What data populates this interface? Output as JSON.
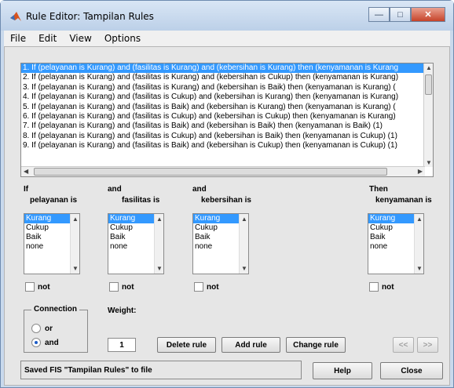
{
  "window": {
    "title": "Rule Editor: Tampilan Rules"
  },
  "menu": [
    "File",
    "Edit",
    "View",
    "Options"
  ],
  "rules": [
    "1. If (pelayanan is Kurang) and (fasilitas is Kurang) and (kebersihan is Kurang) then (kenyamanan is Kurang",
    "2. If (pelayanan is Kurang) and (fasilitas is Kurang) and (kebersihan is Cukup) then (kenyamanan is Kurang)",
    "3. If (pelayanan is Kurang) and (fasilitas is Kurang) and (kebersihan is Baik) then (kenyamanan is Kurang) (",
    "4. If (pelayanan is Kurang) and (fasilitas is Cukup) and (kebersihan is Kurang) then (kenyamanan is Kurang)",
    "5. If (pelayanan is Kurang) and (fasilitas is Baik) and (kebersihan is Kurang) then (kenyamanan is Kurang) (",
    "6. If (pelayanan is Kurang) and (fasilitas is Cukup) and (kebersihan is Cukup) then (kenyamanan is Kurang)",
    "7. If (pelayanan is Kurang) and (fasilitas is Baik) and (kebersihan is Baik) then (kenyamanan is Baik) (1)",
    "8. If (pelayanan is Kurang) and (fasilitas is Cukup) and (kebersihan is Baik) then (kenyamanan is Cukup) (1)",
    "9. If (pelayanan is Kurang) and (fasilitas is Baik) and (kebersihan is Cukup) then (kenyamanan is Cukup) (1)"
  ],
  "columns": [
    {
      "pre": "If",
      "var": "pelayanan is",
      "options": [
        "Kurang",
        "Cukup",
        "Baik",
        "none"
      ],
      "not": "not"
    },
    {
      "pre": "and",
      "var": "fasilitas is",
      "options": [
        "Kurang",
        "Cukup",
        "Baik",
        "none"
      ],
      "not": "not"
    },
    {
      "pre": "and",
      "var": "kebersihan is",
      "options": [
        "Kurang",
        "Cukup",
        "Baik",
        "none"
      ],
      "not": "not"
    },
    {
      "pre": "Then",
      "var": "kenyamanan is",
      "options": [
        "Kurang",
        "Cukup",
        "Baik",
        "none"
      ],
      "not": "not"
    }
  ],
  "connection": {
    "title": "Connection",
    "or": "or",
    "and": "and"
  },
  "weight": {
    "label": "Weight:",
    "value": "1"
  },
  "buttons": {
    "delete": "Delete rule",
    "add": "Add rule",
    "change": "Change rule",
    "prev": "<<",
    "next": ">>",
    "help": "Help",
    "close": "Close"
  },
  "status": "Saved FIS \"Tampilan Rules\" to file"
}
